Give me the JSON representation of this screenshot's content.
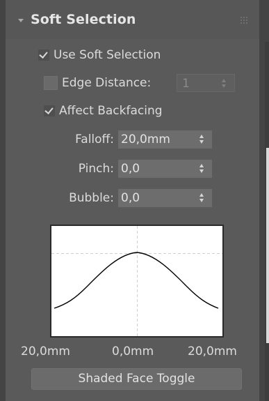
{
  "rollout": {
    "title": "Soft Selection"
  },
  "checkboxes": {
    "use_soft_selection": {
      "label": "Use Soft Selection",
      "checked": true
    },
    "edge_distance": {
      "label": "Edge Distance:",
      "checked": false,
      "value": "1"
    },
    "affect_backfacing": {
      "label": "Affect Backfacing",
      "checked": true
    }
  },
  "spinners": {
    "falloff": {
      "label": "Falloff:",
      "value": "20,0mm"
    },
    "pinch": {
      "label": "Pinch:",
      "value": "0,0"
    },
    "bubble": {
      "label": "Bubble:",
      "value": "0,0"
    }
  },
  "curve": {
    "left_label": "20,0mm",
    "center_label": "0,0mm",
    "right_label": "20,0mm"
  },
  "buttons": {
    "shaded_face_toggle": "Shaded Face Toggle"
  },
  "icons": {
    "collapse": "triangle-down-icon",
    "grip": "grip-dots-icon"
  }
}
